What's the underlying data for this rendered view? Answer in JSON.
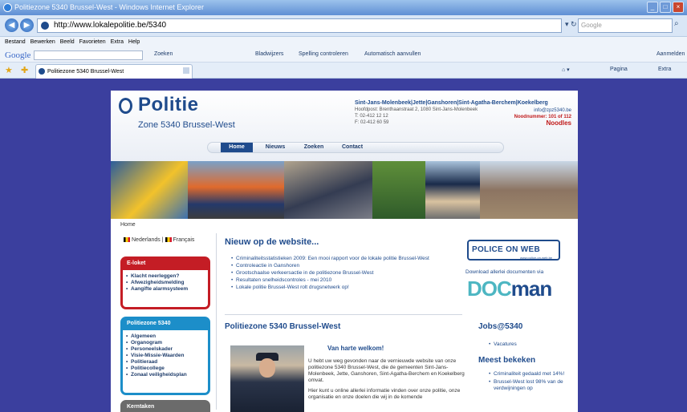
{
  "window": {
    "title": "Politiezone 5340 Brussel-West - Windows Internet Explorer"
  },
  "address": {
    "url": "http://www.lokalepolitie.be/5340",
    "search_placeholder": "Google"
  },
  "menu": [
    "Bestand",
    "Bewerken",
    "Beeld",
    "Favorieten",
    "Extra",
    "Help"
  ],
  "google_toolbar": {
    "logo": "Google",
    "tools": [
      "Zoeken",
      "Bladwijzers",
      "Spelling controleren",
      "Automatisch aanvullen"
    ],
    "signin": "Aanmelden"
  },
  "tab": {
    "title": "Politiezone 5340 Brussel-West"
  },
  "command_bar": {
    "page": "Pagina",
    "extra": "Extra"
  },
  "site": {
    "logo_title": "Politie",
    "logo_zone": "Zone 5340 Brussel-West",
    "header_title": "Sint-Jans-Molenbeek|Jette|Ganshoren|Sint-Agatha-Berchem|Koekelberg",
    "address_line": "Hoofdpost: Brenthaanstraat 2, 1080 Sint-Jans-Molenbeek",
    "phone": "T: 02-412 12 12",
    "fax": "F: 02-412 60 59",
    "email": "info@zpz5340.be",
    "urgent": "Noodnummer: 101 of 112",
    "urgent_link": "Noodles",
    "nav": [
      "Home",
      "Nieuws",
      "Zoeken",
      "Contact"
    ],
    "breadcrumb": "Home",
    "lang": {
      "nl": "Nederlands",
      "fr": "Français"
    },
    "eloket": {
      "title": "E-loket",
      "items": [
        "Klacht neerleggen?",
        "Afwezigheidsmelding",
        "Aangifte alarmsysteem"
      ]
    },
    "zone_box": {
      "title": "Politiezone 5340",
      "items": [
        "Algemeen",
        "Organogram",
        "Personeelskader",
        "Visie-Missie-Waarden",
        "Politieraad",
        "Politiecollege",
        "Zonaal veiligheidsplan"
      ]
    },
    "kern_box": {
      "title": "Kerntaken"
    },
    "news_title": "Nieuw op de website...",
    "news": [
      "Criminaliteitsstatistieken 2009: Een mooi rapport voor de lokale politie Brussel-West",
      "Controleactie in Ganshoren",
      "Grootschaalse verkeersactie in de politiezone Brussel-West",
      "Resultaten snelheidscontroles - mei 2010",
      "Lokale politie Brussel-West rolt drugsnetwerk op!"
    ],
    "zone_title": "Politiezone 5340 Brussel-West",
    "welcome_title": "Van harte welkom!",
    "welcome_p1": "U hebt uw weg gevonden naar de vernieuwde website van onze politiezone 5340 Brussel-West, die de gemeenten Sint-Jans-Molenbeek, Jette, Ganshoren, Sint-Agatha-Berchem en Koekelberg omvat.",
    "welcome_p2": "Hier kunt u online allerlei informatie vinden over onze politie, onze organisatie en onze doelen die wij in de komende",
    "police_on_web": "POLICE ON WEB",
    "police_sub": "www.police-on-web.be",
    "doc_text": "Download allerlei documenten via",
    "docman_a": "DOC",
    "docman_b": "man",
    "jobs_title": "Jobs@5340",
    "jobs": [
      "Vacatures"
    ],
    "meest_title": "Meest bekeken",
    "meest": [
      "Criminaliteit gedaald met 14%!",
      "Brussel-West lost 98% van de verdwijningen op"
    ]
  }
}
